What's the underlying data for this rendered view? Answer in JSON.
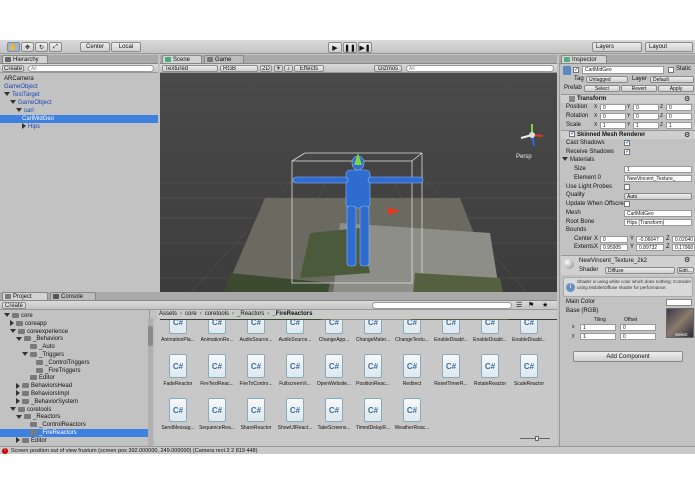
{
  "toolbar": {
    "pivot_label": "Center",
    "space_label": "Local",
    "layers_label": "Layers",
    "layout_label": "Layout"
  },
  "hierarchy": {
    "tab": "Hierarchy",
    "create": "Create",
    "search": "All",
    "items": [
      {
        "label": "ARCamera",
        "indent": 0,
        "arrow": "none",
        "sel": false,
        "prefab": false
      },
      {
        "label": "GameObject",
        "indent": 0,
        "arrow": "none",
        "sel": false,
        "prefab": true
      },
      {
        "label": "TestTarget",
        "indent": 0,
        "arrow": "down",
        "sel": false,
        "prefab": true
      },
      {
        "label": "GameObject",
        "indent": 1,
        "arrow": "down",
        "sel": false,
        "prefab": true
      },
      {
        "label": "carl",
        "indent": 2,
        "arrow": "down",
        "sel": false,
        "prefab": true
      },
      {
        "label": "CarlMidGeo",
        "indent": 3,
        "arrow": "none",
        "sel": true,
        "prefab": true
      },
      {
        "label": "Hips",
        "indent": 3,
        "arrow": "right",
        "sel": false,
        "prefab": true
      }
    ]
  },
  "scene": {
    "tab_scene": "Scene",
    "tab_game": "Game",
    "shading": "Textured",
    "mode": "RGB",
    "size": "2D",
    "effects": "Effects",
    "gizmos": "Gizmos",
    "search": "All",
    "persp": "Persp"
  },
  "project": {
    "tab_project": "Project",
    "tab_console": "Console",
    "create": "Create",
    "breadcrumb": [
      "Assets",
      "core",
      "coretools",
      "_Reactors",
      "_FireReactors"
    ],
    "tree": [
      {
        "label": "core",
        "indent": 0,
        "arrow": "down",
        "sel": false
      },
      {
        "label": "coreapp",
        "indent": 1,
        "arrow": "right",
        "sel": false
      },
      {
        "label": "coreexperience",
        "indent": 1,
        "arrow": "down",
        "sel": false
      },
      {
        "label": "_Behaviors",
        "indent": 2,
        "arrow": "down",
        "sel": false
      },
      {
        "label": "_Auto",
        "indent": 3,
        "arrow": "none",
        "sel": false
      },
      {
        "label": "_Triggers",
        "indent": 3,
        "arrow": "down",
        "sel": false
      },
      {
        "label": "_ControlTriggers",
        "indent": 4,
        "arrow": "none",
        "sel": false
      },
      {
        "label": "_FireTriggers",
        "indent": 4,
        "arrow": "none",
        "sel": false
      },
      {
        "label": "Editor",
        "indent": 3,
        "arrow": "none",
        "sel": false
      },
      {
        "label": "BehaviorsHead",
        "indent": 2,
        "arrow": "right",
        "sel": false
      },
      {
        "label": "BehaviorsImpl",
        "indent": 2,
        "arrow": "right",
        "sel": false
      },
      {
        "label": "_BehaviorSystem",
        "indent": 2,
        "arrow": "right",
        "sel": false
      },
      {
        "label": "coretools",
        "indent": 1,
        "arrow": "down",
        "sel": false
      },
      {
        "label": "_Reactors",
        "indent": 2,
        "arrow": "down",
        "sel": false
      },
      {
        "label": "_ControlReactors",
        "indent": 3,
        "arrow": "none",
        "sel": false
      },
      {
        "label": "_FireReactors",
        "indent": 3,
        "arrow": "none",
        "sel": true
      },
      {
        "label": "Editor",
        "indent": 2,
        "arrow": "right",
        "sel": false
      }
    ],
    "assets_row1": [
      "AnimationPla...",
      "AnimationRe...",
      "AudioSource...",
      "AudioSource...",
      "ChangeApp...",
      "ChangeMater...",
      "ChangeTextu...",
      "EnableDisabl...",
      "EnableDisabl...",
      "EnableDisabl..."
    ],
    "assets_row2": [
      "FadeReactor",
      "FireTestReac...",
      "FireToContro...",
      "FullscreenVi...",
      "OpenWebsite...",
      "PositionReac...",
      "Redirect",
      "ResetTimerR...",
      "RotateReactor",
      "ScaleReactor"
    ],
    "assets_row3": [
      "SendMessag...",
      "SequenceRea...",
      "ShareReactor",
      "ShowUIReact...",
      "TakeScreens...",
      "TimedDelayR...",
      "WeatherReac..."
    ],
    "asset_icon": "C#"
  },
  "inspector": {
    "tab": "Inspector",
    "object_name": "CarlMidGeo",
    "static_label": "Static",
    "tag_label": "Tag",
    "tag_value": "Untagged",
    "layer_label": "Layer",
    "layer_value": "Default",
    "prefab_label": "Prefab",
    "select": "Select",
    "revert": "Revert",
    "apply": "Apply",
    "transform": {
      "title": "Transform",
      "rows": [
        {
          "label": "Position",
          "x": "0",
          "y": "0",
          "z": "0"
        },
        {
          "label": "Rotation",
          "x": "0",
          "y": "0",
          "z": "0"
        },
        {
          "label": "Scale",
          "x": "1",
          "y": "1",
          "z": "1"
        }
      ]
    },
    "smr": {
      "title": "Skinned Mesh Renderer",
      "cast_shadows": "Cast Shadows",
      "receive_shadows": "Receive Shadows",
      "materials": "Materials",
      "size_label": "Size",
      "size_value": "1",
      "element0_label": "Element 0",
      "element0_value": "NewVincent_Texture_",
      "use_light_probes": "Use Light Probes",
      "quality_label": "Quality",
      "quality_value": "Auto",
      "update_offscreen": "Update When Offscree",
      "mesh_label": "Mesh",
      "mesh_value": "CarlMidGeo",
      "root_bone_label": "Root Bone",
      "root_bone_value": "Hips (Transform)",
      "bounds_label": "Bounds",
      "center_label": "Center",
      "center_x": "0",
      "center_y": "-0.06647",
      "center_z": "0.02040",
      "extents_label": "Extents",
      "extents_x": "0.95905",
      "extents_y": "0.89732",
      "extents_z": "0.17968"
    },
    "material": {
      "name": "NewVincent_Texture_2k2",
      "shader_label": "Shader",
      "shader_value": "Diffuse",
      "edit": "Edit...",
      "warning": "Shader is using white color which does nothing; Consider using Mobile/Diffuse shader for performance.",
      "main_color": "Main Color",
      "base_rgb": "Base (RGB)",
      "tiling": "Tiling",
      "offset": "Offset",
      "tx": "1",
      "ox": "0",
      "ty": "1",
      "oy": "0",
      "select": "Select"
    },
    "add_component": "Add Component"
  },
  "status": {
    "message": "Screen position out of view frustum (screen pos 392.000000, 249.000000) (Camera rect 2 2 819 448)",
    "icon": "error-icon"
  },
  "colors": {
    "selection": "#3d80df",
    "prefab_text": "#1a46b8",
    "error": "#cc0000"
  }
}
